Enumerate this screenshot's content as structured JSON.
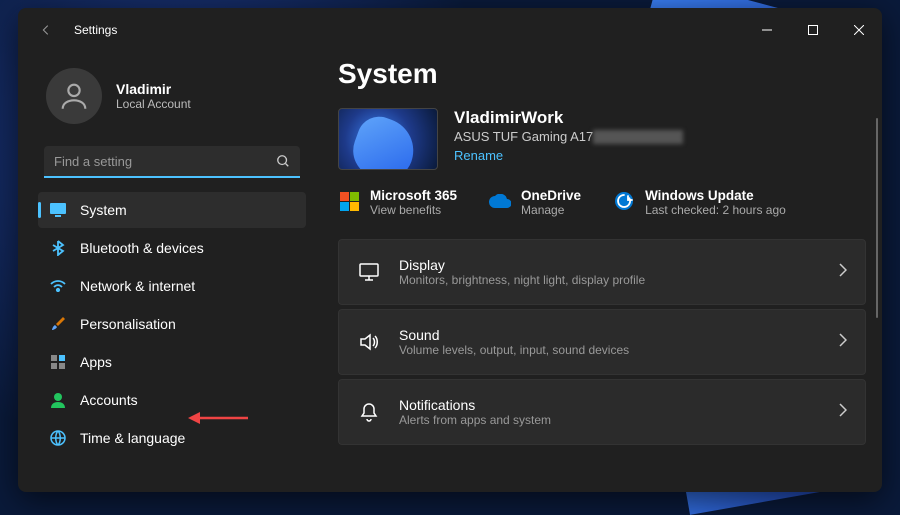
{
  "window": {
    "title": "Settings"
  },
  "profile": {
    "name": "Vladimir",
    "account_type": "Local Account"
  },
  "search": {
    "placeholder": "Find a setting"
  },
  "nav": {
    "system": "System",
    "bluetooth": "Bluetooth & devices",
    "network": "Network & internet",
    "personalisation": "Personalisation",
    "apps": "Apps",
    "accounts": "Accounts",
    "time": "Time & language"
  },
  "main": {
    "heading": "System",
    "device": {
      "name": "VladimirWork",
      "model_prefix": "ASUS TUF Gaming A17 ",
      "rename": "Rename"
    },
    "quick": {
      "m365": {
        "title": "Microsoft 365",
        "sub": "View benefits"
      },
      "onedrive": {
        "title": "OneDrive",
        "sub": "Manage"
      },
      "update": {
        "title": "Windows Update",
        "sub": "Last checked: 2 hours ago"
      }
    },
    "cards": {
      "display": {
        "title": "Display",
        "sub": "Monitors, brightness, night light, display profile"
      },
      "sound": {
        "title": "Sound",
        "sub": "Volume levels, output, input, sound devices"
      },
      "notifications": {
        "title": "Notifications",
        "sub": "Alerts from apps and system"
      }
    }
  }
}
